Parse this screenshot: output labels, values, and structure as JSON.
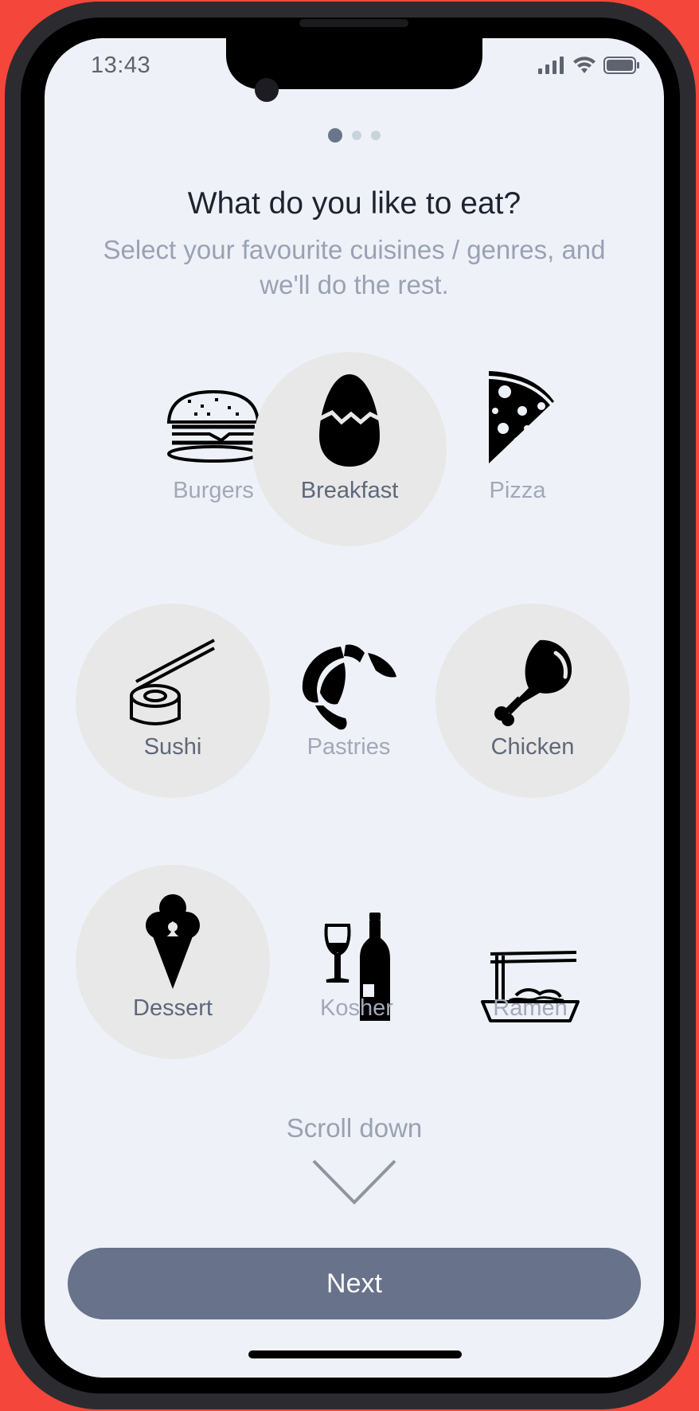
{
  "status_bar": {
    "time": "13:43",
    "icons": [
      "signal-icon",
      "wifi-icon",
      "battery-icon"
    ]
  },
  "pager": {
    "total": 3,
    "current": 1
  },
  "header": {
    "title": "What do you like to eat?",
    "subtitle": "Select your favourite cuisines / genres, and we'll do the rest."
  },
  "cuisines": [
    {
      "label": "Burgers",
      "icon": "burger-icon",
      "selected": false
    },
    {
      "label": "Breakfast",
      "icon": "egg-icon",
      "selected": true
    },
    {
      "label": "Pizza",
      "icon": "pizza-icon",
      "selected": false
    },
    {
      "label": "Sushi",
      "icon": "sushi-icon",
      "selected": true
    },
    {
      "label": "Pastries",
      "icon": "croissant-icon",
      "selected": false
    },
    {
      "label": "Chicken",
      "icon": "chicken-leg-icon",
      "selected": true
    },
    {
      "label": "Dessert",
      "icon": "ice-cream-icon",
      "selected": true
    },
    {
      "label": "Kosher",
      "icon": "wine-icon",
      "selected": false
    },
    {
      "label": "Ramen",
      "icon": "ramen-icon",
      "selected": false
    }
  ],
  "scroll_hint": "Scroll down",
  "next_button": "Next",
  "colors": {
    "frame_background": "#f4463a",
    "screen_background": "#eef2f8",
    "selected_circle": "#e8e8e8",
    "accent": "#68728a"
  }
}
